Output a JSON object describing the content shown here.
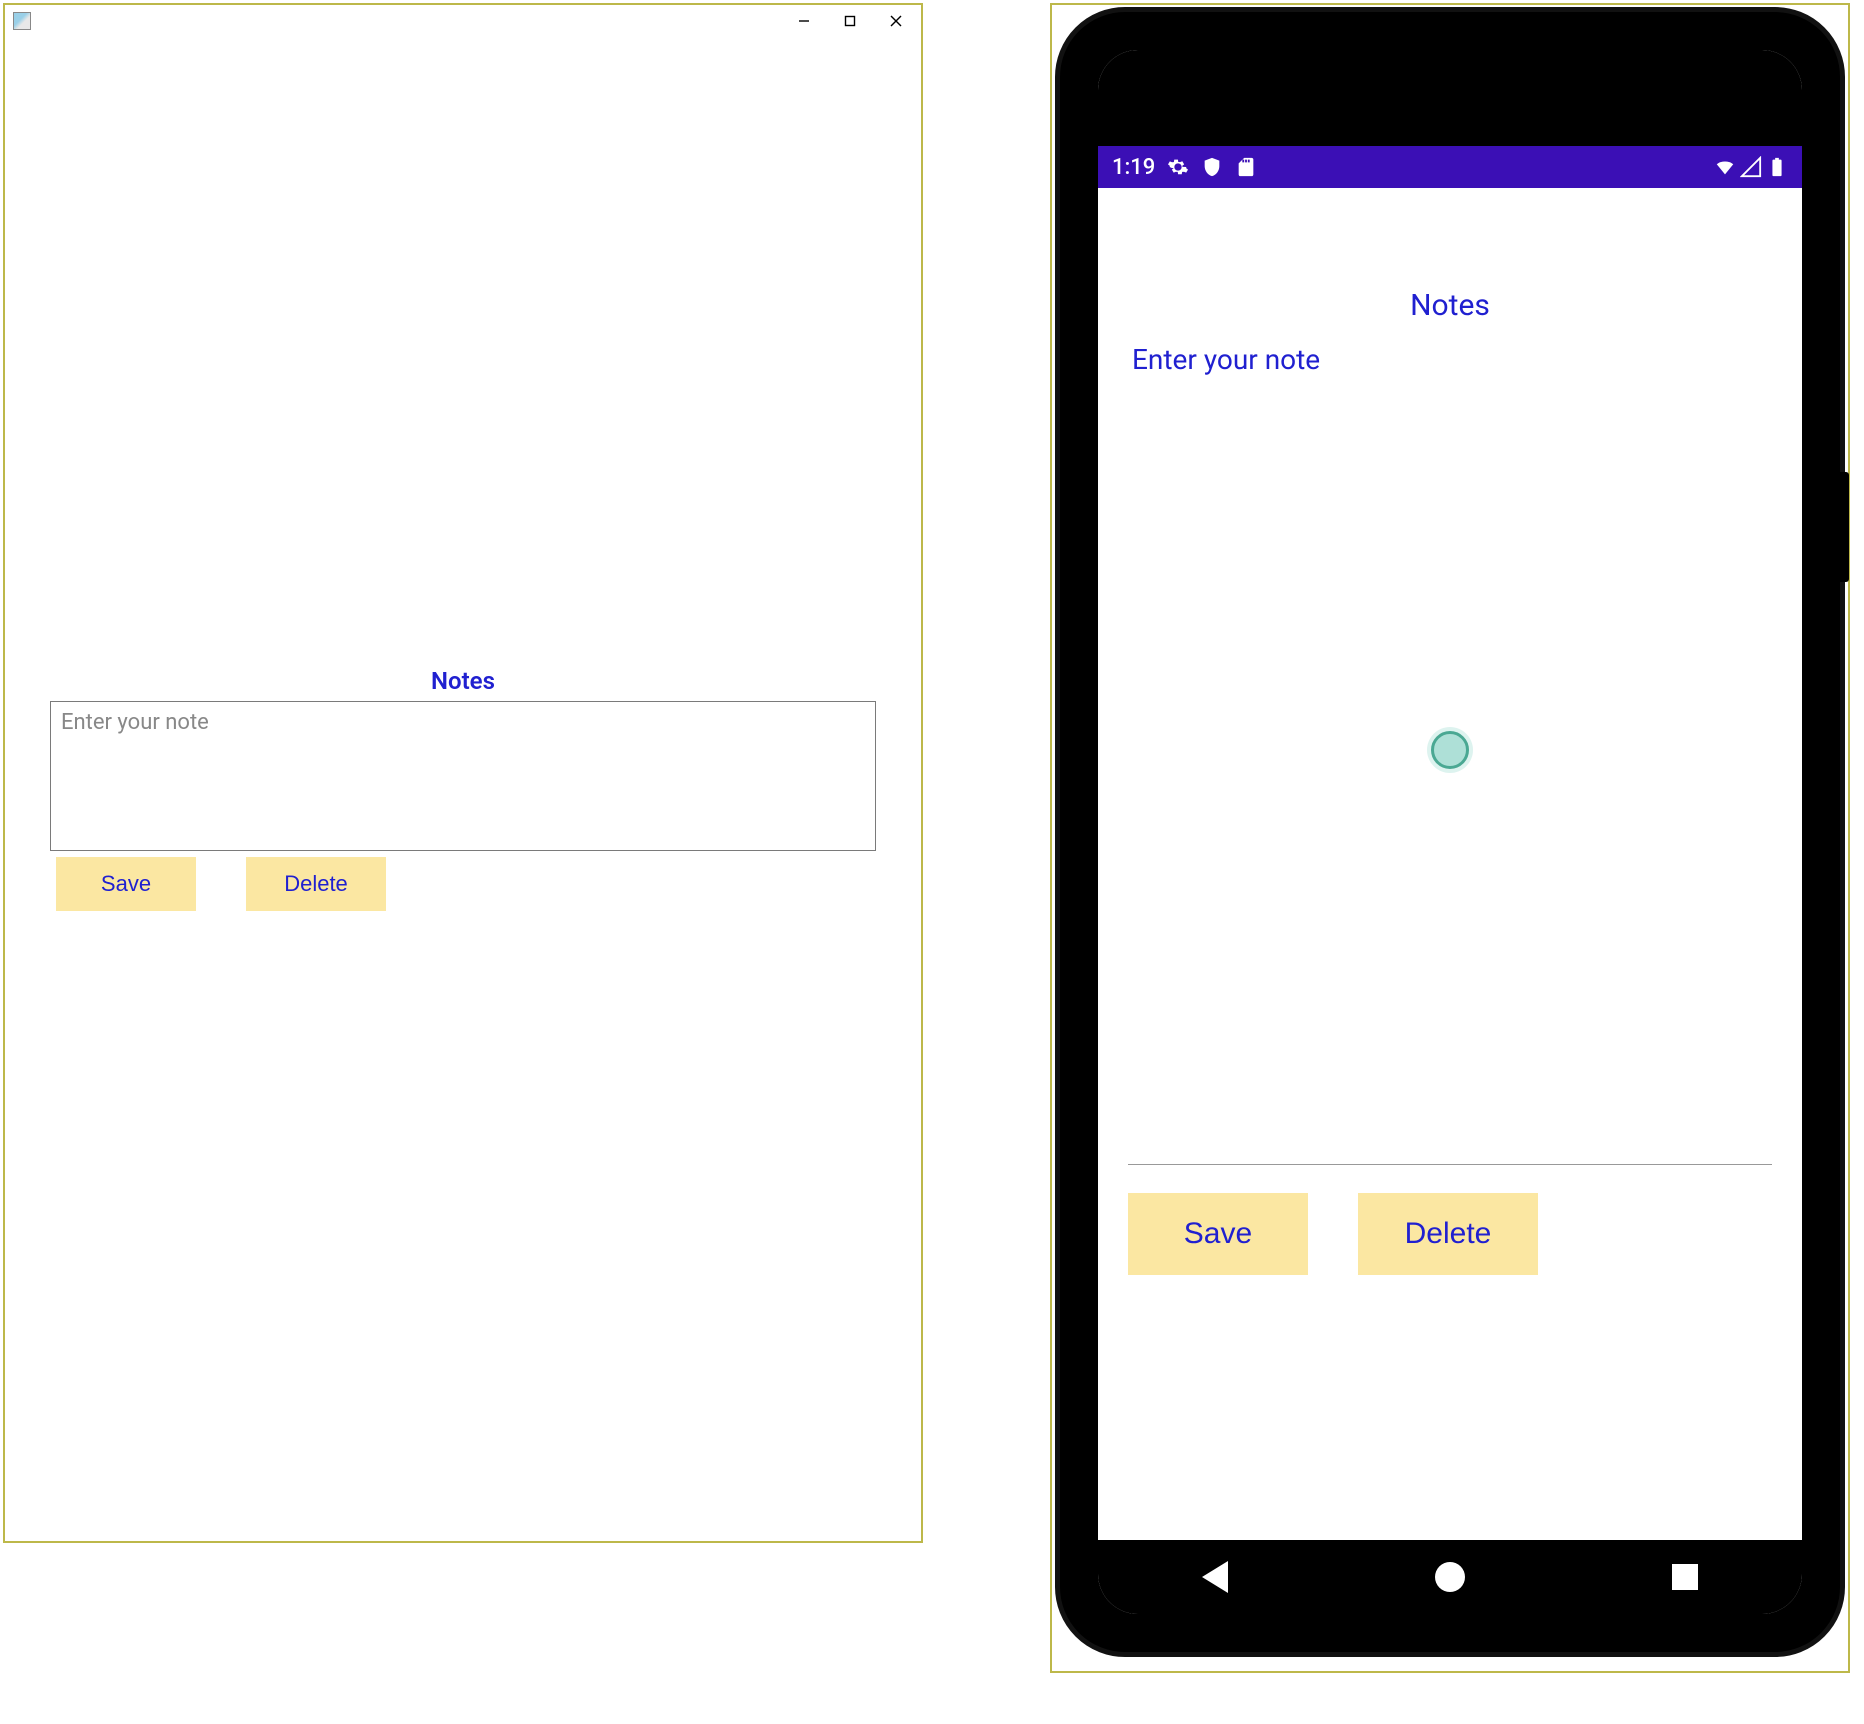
{
  "desktop": {
    "title": "Notes",
    "note_placeholder": "Enter your note",
    "save_label": "Save",
    "delete_label": "Delete"
  },
  "phone": {
    "status": {
      "time": "1:19"
    },
    "title": "Notes",
    "note_placeholder": "Enter your note",
    "save_label": "Save",
    "delete_label": "Delete"
  },
  "colors": {
    "accent": "#2020d0",
    "button_bg": "#fbe7a2",
    "statusbar": "#3b0fb5",
    "outline": "#bdb84a"
  }
}
